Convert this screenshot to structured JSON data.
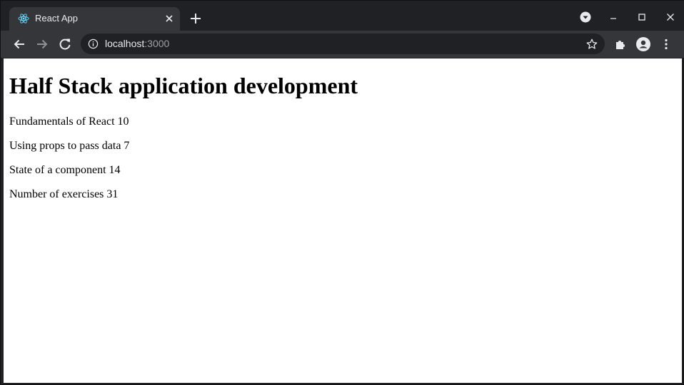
{
  "browser": {
    "tab": {
      "title": "React App",
      "favicon": "react-logo-icon"
    },
    "window_controls": [
      "tab-search-icon",
      "minimize-icon",
      "maximize-icon",
      "close-window-icon"
    ],
    "toolbar": {
      "back": "arrow-left-icon",
      "forward": "arrow-right-icon",
      "reload": "reload-icon",
      "extensions": "puzzle-icon",
      "profile": "avatar-icon",
      "menu": "kebab-menu-icon"
    },
    "address": {
      "host": "localhost",
      "port": ":3000",
      "site_info": "info-icon",
      "bookmark": "star-icon"
    },
    "colors": {
      "frame": "#202124",
      "toolbar": "#35363a",
      "text": "#e8eaed",
      "react": "#61dafb"
    }
  },
  "page": {
    "heading": "Half Stack application development",
    "parts": [
      "Fundamentals of React 10",
      "Using props to pass data 7",
      "State of a component 14"
    ],
    "total": "Number of exercises 31"
  }
}
